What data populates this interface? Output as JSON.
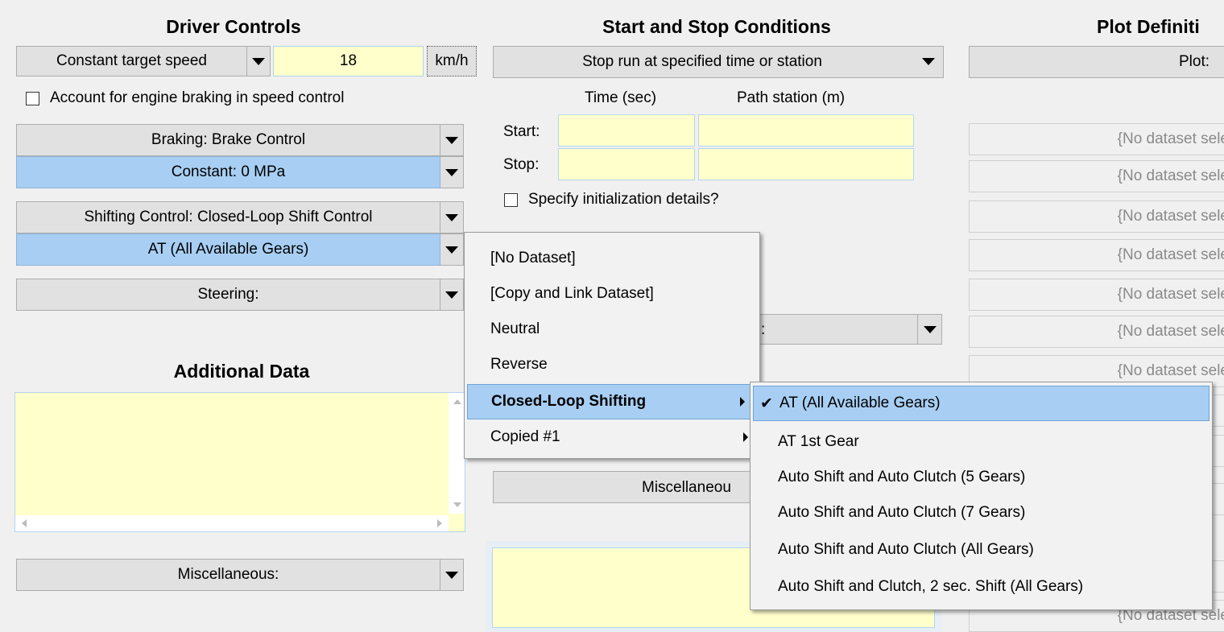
{
  "driver_controls": {
    "heading": "Driver Controls",
    "speed_mode": "Constant target speed",
    "speed_value": "18",
    "speed_unit": "km/h",
    "engine_braking_label": "Account for engine braking in speed control",
    "braking_label": "Braking: Brake Control",
    "braking_dataset": "Constant: 0 MPa",
    "shifting_label": "Shifting Control: Closed-Loop Shift Control",
    "shifting_dataset": "AT (All Available Gears)",
    "steering_label": "Steering:"
  },
  "additional_data": {
    "heading": "Additional Data",
    "misc_label": "Miscellaneous:"
  },
  "start_stop": {
    "heading": "Start and Stop Conditions",
    "mode": "Stop run at specified time or station",
    "col_time": "Time (sec)",
    "col_station": "Path station (m)",
    "row_start": "Start:",
    "row_stop": "Stop:",
    "init_label": "Specify initialization details?",
    "misc_label": "Miscellaneou",
    "hidden_dd_label": ":"
  },
  "plot": {
    "heading": "Plot Definiti",
    "plot_label": "Plot:",
    "datasets": [
      "{No dataset sele",
      "{No dataset sele",
      "{No dataset sele",
      "{No dataset sele",
      "{No dataset sele",
      "{No dataset sele",
      "{No dataset sele",
      "{No dataset sele"
    ],
    "partials": [
      "le",
      "le",
      "le"
    ]
  },
  "context_menu": {
    "items": [
      "[No Dataset]",
      "[Copy and Link Dataset]",
      "Neutral",
      "Reverse",
      "Closed-Loop Shifting",
      "Copied #1"
    ],
    "highlighted": "Closed-Loop Shifting"
  },
  "submenu": {
    "check_glyph": "✔",
    "items": [
      "AT (All Available Gears)",
      "AT 1st Gear",
      "Auto Shift and Auto Clutch (5 Gears)",
      "Auto Shift and Auto Clutch (7 Gears)",
      "Auto Shift and Auto Clutch (All Gears)",
      "Auto Shift and Clutch, 2 sec. Shift (All Gears)"
    ],
    "selected": "AT (All Available Gears)"
  }
}
